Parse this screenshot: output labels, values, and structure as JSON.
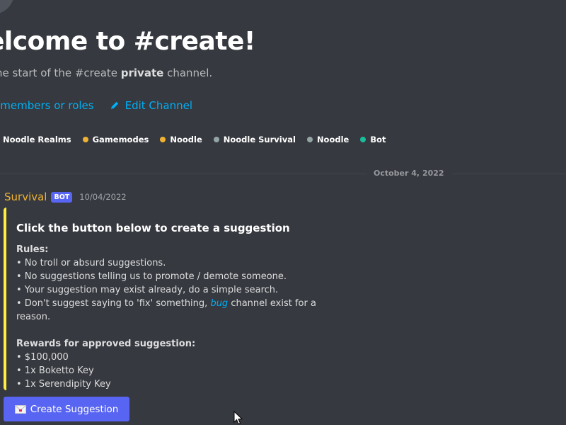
{
  "welcome": {
    "title": "elcome to #create!",
    "subtitle_prefix": "he start of the #create ",
    "subtitle_bold": "private",
    "subtitle_suffix": " channel."
  },
  "actions": {
    "add_members": "d members or roles",
    "edit_channel": "Edit Channel"
  },
  "roles": [
    {
      "label": "Noodle Realms",
      "color": "#f0b232"
    },
    {
      "label": "Gamemodes",
      "color": "#f0b232"
    },
    {
      "label": "Noodle",
      "color": "#f0b232"
    },
    {
      "label": "Noodle Survival",
      "color": "#95a5a6"
    },
    {
      "label": "Noodle",
      "color": "#95a5a6"
    },
    {
      "label": "Bot",
      "color": "#1abc9c"
    }
  ],
  "divider": {
    "date": "October 4, 2022"
  },
  "message": {
    "username": "Survival",
    "bot_tag": "BOT",
    "timestamp": "10/04/2022"
  },
  "embed": {
    "accent_color": "#ffee3f",
    "title": "Click the button below to create a suggestion",
    "rules_heading": "Rules:",
    "rule_1": "• No troll or absurd suggestions.",
    "rule_2": "• No suggestions telling us to promote / demote someone.",
    "rule_3": "• Your suggestion may exist already, do a simple search.",
    "rule_4_prefix": "• Don't suggest saying to 'fix' something, ",
    "rule_4_link": "bug",
    "rule_4_suffix": " channel exist for a reason.",
    "rewards_heading": "Rewards for approved suggestion:",
    "reward_1": "• $100,000",
    "reward_2": "• 1x Boketto Key",
    "reward_3": "• 1x Serendipity Key"
  },
  "button": {
    "icon": "envelope-icon",
    "label": "Create Suggestion",
    "color": "#5865f2"
  }
}
